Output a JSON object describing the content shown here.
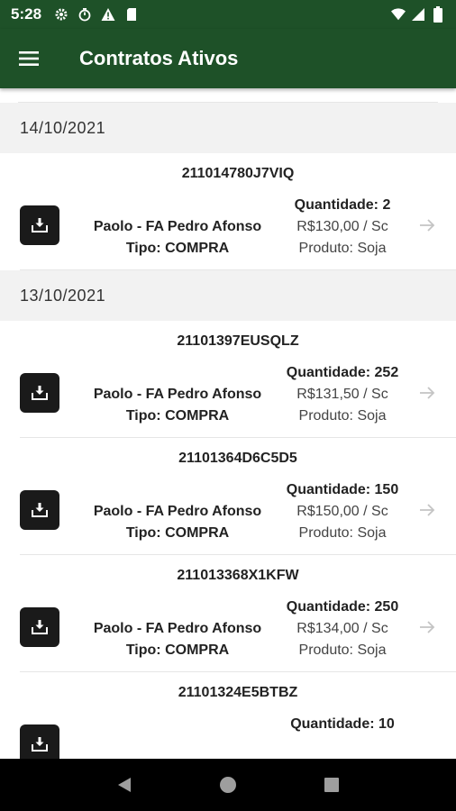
{
  "status_bar": {
    "time": "5:28",
    "left_icons": [
      "gear-icon",
      "stopwatch-icon",
      "warning-icon",
      "sd-card-icon"
    ],
    "right_icons": [
      "wifi-icon",
      "signal-icon",
      "battery-icon"
    ]
  },
  "app_bar": {
    "menu_icon": "menu-icon",
    "title": "Contratos Ativos"
  },
  "groups": [
    {
      "date": "14/10/2021",
      "contracts": [
        {
          "id": "211014780J7VIQ",
          "party": "Paolo - FA Pedro Afonso",
          "tipo": "Tipo: COMPRA",
          "quantidade": "Quantidade: 2",
          "preco": "R$130,00 / Sc",
          "produto": "Produto: Soja"
        }
      ]
    },
    {
      "date": "13/10/2021",
      "contracts": [
        {
          "id": "21101397EUSQLZ",
          "party": "Paolo - FA Pedro Afonso",
          "tipo": "Tipo: COMPRA",
          "quantidade": "Quantidade: 252",
          "preco": "R$131,50 / Sc",
          "produto": "Produto: Soja"
        },
        {
          "id": "21101364D6C5D5",
          "party": "Paolo - FA Pedro Afonso",
          "tipo": "Tipo: COMPRA",
          "quantidade": "Quantidade: 150",
          "preco": "R$150,00 / Sc",
          "produto": "Produto: Soja"
        },
        {
          "id": "211013368X1KFW",
          "party": "Paolo - FA Pedro Afonso",
          "tipo": "Tipo: COMPRA",
          "quantidade": "Quantidade: 250",
          "preco": "R$134,00 / Sc",
          "produto": "Produto: Soja"
        },
        {
          "id": "21101324E5BTBZ",
          "party": "",
          "tipo": "",
          "quantidade": "Quantidade: 10",
          "preco": "",
          "produto": ""
        }
      ]
    }
  ],
  "nav_bar": {
    "buttons": [
      "back-icon",
      "home-icon",
      "recents-icon"
    ]
  },
  "colors": {
    "primary": "#1e5128",
    "header_bg": "#f2f2f2",
    "button_bg": "#1a1a1a"
  }
}
